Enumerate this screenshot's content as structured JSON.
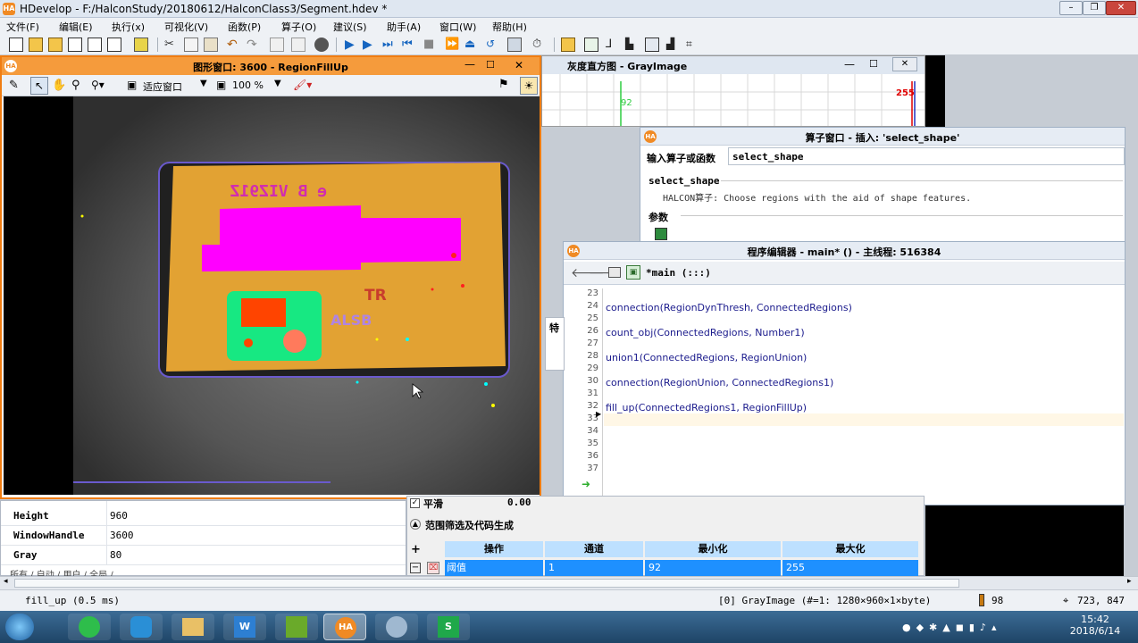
{
  "app": {
    "title": "HDevelop - F:/HalconStudy/20180612/HalconClass3/Segment.hdev *",
    "logo_text": "HA"
  },
  "menu": [
    "文件(F)",
    "编辑(E)",
    "执行(x)",
    "可视化(V)",
    "函数(P)",
    "算子(O)",
    "建议(S)",
    "助手(A)",
    "窗口(W)",
    "帮助(H)"
  ],
  "graphics_window": {
    "title": "图形窗口: 3600 - RegionFillUp",
    "fit_label": "适应窗口",
    "zoom": "100 %"
  },
  "histogram_window": {
    "title": "灰度直方图 - GrayImage",
    "marker_left": "92",
    "marker_right": "255"
  },
  "operator_window": {
    "title": "算子窗口 - 插入: 'select_shape'",
    "input_label": "输入算子或函数",
    "input_value": "select_shape",
    "op_name": "select_shape",
    "op_desc": "HALCON算子: Choose regions with the aid of shape features.",
    "params_label": "参数"
  },
  "program_editor": {
    "title": "程序编辑器 - main* () - 主线程: 516384",
    "proc_label": "*main (:::)",
    "lines": [
      {
        "n": "23",
        "code": ""
      },
      {
        "n": "24",
        "code": "connection(RegionDynThresh, ConnectedRegions)"
      },
      {
        "n": "25",
        "code": ""
      },
      {
        "n": "26",
        "code": "count_obj(ConnectedRegions, Number1)"
      },
      {
        "n": "27",
        "code": ""
      },
      {
        "n": "28",
        "code": "union1(ConnectedRegions, RegionUnion)"
      },
      {
        "n": "29",
        "code": ""
      },
      {
        "n": "30",
        "code": "connection(RegionUnion, ConnectedRegions1)"
      },
      {
        "n": "31",
        "code": ""
      },
      {
        "n": "32",
        "code": "fill_up(ConnectedRegions1, RegionFillUp)"
      },
      {
        "n": "33",
        "code": ""
      },
      {
        "n": "34",
        "code": ""
      },
      {
        "n": "35",
        "code": ""
      },
      {
        "n": "36",
        "code": ""
      },
      {
        "n": "37",
        "code": ""
      }
    ]
  },
  "variables": [
    {
      "name": "Height",
      "value": "960"
    },
    {
      "name": "WindowHandle",
      "value": "3600"
    },
    {
      "name": "Gray",
      "value": "80"
    }
  ],
  "variables_tabs": "所有 ∕ 自动 ∕ 用户 ∕ 全局 ∕",
  "gray_settings": {
    "partial_label": "平滑",
    "partial_value": "0.00",
    "section_title": "范围筛选及代码生成",
    "plus": "+",
    "minus": "−",
    "headers": [
      "操作",
      "通道",
      "最小化",
      "最大化"
    ],
    "row": [
      "阈值",
      "1",
      "92",
      "255"
    ]
  },
  "side_label": "特",
  "status": {
    "message": "fill_up (0.5 ms)",
    "image_info": "[0] GrayImage (#=1: 1280×960×1×byte)",
    "gray_value": "98",
    "coords": "723, 847"
  },
  "taskbar": {
    "time": "15:42",
    "date": "2018/6/14"
  },
  "colors": {
    "graphics_accent": "#f07d12",
    "board_region": "#e2a233",
    "magenta_region": "#ff00ff",
    "green_region": "#17e882",
    "red_region": "#ff4400",
    "highlight_row": "#1e90ff"
  }
}
